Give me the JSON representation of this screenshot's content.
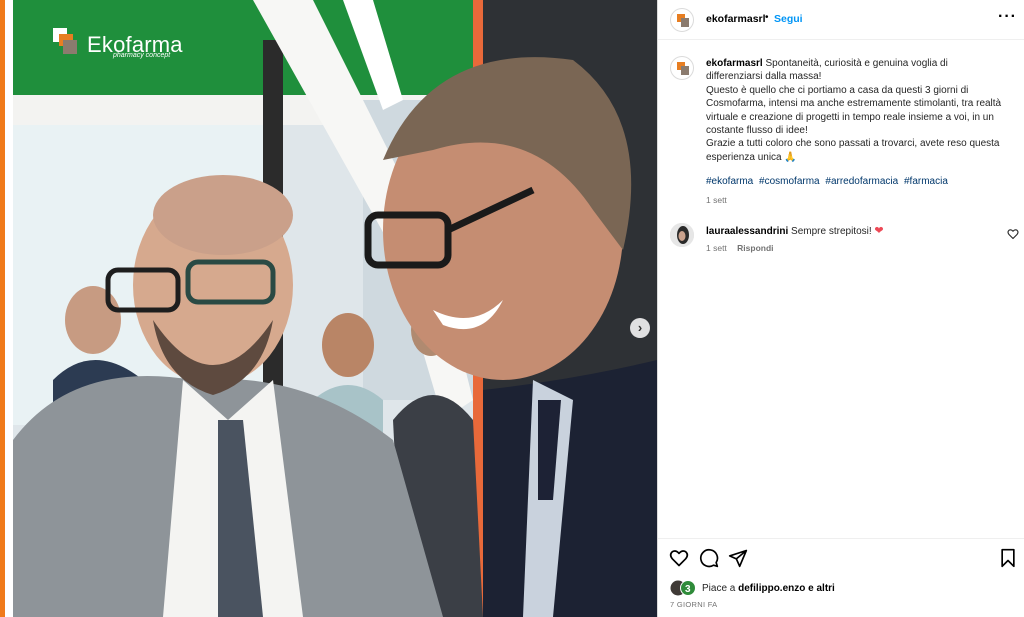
{
  "photo": {
    "brand_name": "Ekofarma",
    "brand_tagline": "pharmacy concept",
    "next_symbol": "›"
  },
  "header": {
    "username": "ekofarmasrl",
    "separator": "•",
    "follow_label": "Segui",
    "more_symbol": "···"
  },
  "caption": {
    "username": "ekofarmasrl",
    "lines": [
      "Spontaneità, curiosità e genuina voglia di differenziarsi dalla massa!",
      "Questo è quello che ci portiamo a casa da questi 3 giorni di Cosmofarma, intensi ma anche estremamente stimolanti, tra realtà virtuale e creazione di progetti in tempo reale insieme a voi, in un costante flusso di idee!",
      "Grazie a tutti coloro che sono passati a trovarci, avete reso questa esperienza unica 🙏"
    ],
    "hashtags": [
      "#ekofarma",
      "#cosmofarma",
      "#arredofarmacia",
      "#farmacia"
    ],
    "time": "1 sett"
  },
  "comment": {
    "username": "lauraalessandrini",
    "text": "Sempre strepitosi!",
    "emoji": "❤",
    "time": "1 sett",
    "reply_label": "Rispondi"
  },
  "likes": {
    "prefix": "Piace a",
    "user": "defilippo.enzo",
    "suffix": "e altri",
    "ago": "7 GIORNI FA"
  },
  "colors": {
    "accent_orange": "#f07a1a",
    "brand_green": "#1a8a3a",
    "link_blue": "#0095f6",
    "hashtag_blue": "#00376b",
    "heart_red": "#ed4956"
  },
  "icons": [
    "heart-icon",
    "comment-icon",
    "share-icon",
    "bookmark-icon",
    "more-icon",
    "chevron-right-icon"
  ]
}
